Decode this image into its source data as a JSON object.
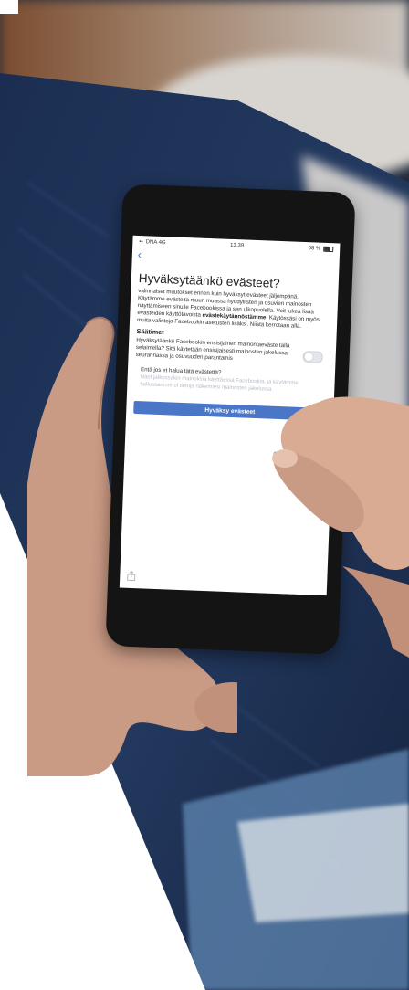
{
  "status_bar": {
    "carrier": "DNA 4G",
    "time": "13.39",
    "battery": "68 %"
  },
  "nav": {
    "back_icon": "chevron-left-icon"
  },
  "dialog": {
    "title": "Hyväksytäänkö evästeet?",
    "intro": "valinnaiset muutokset ennen kuin hyväksyt evästeet jäljempänä.",
    "body_before_link": "Käytämme evästeitä muun muassa hyödyllisten ja osuvien mainosten näyttämiseen sinulle Facebookissa ja sen ulkopuolella. Voit lukea lisää evästeiden käyttötavoista",
    "policy_link": "evästekäytännöstämme",
    "body_after_link": ". Käytössäsi on myös muita valintoja Facebookin asetusten lisäksi. Niistä kerrotaan alla.",
    "controls_title": "Säätimet",
    "toggle_text": "Hyväksytäänkö Facebookin ensisijainen mainontaeväste tällä selaimella? Sitä käytetään ensisijaisesti mainosten jakelussa, seurannassa ja osuvuuden parantamis",
    "question": "Entä jos et halua tätä evästettä?",
    "answer": "Näet jatkossakin mainoksia käyttäessä Facebookia, ja käytämme hallussamme ol tietoja näkemiesi mainosten jakelussa.",
    "accept_button": "Hyväksy evästeet",
    "share_icon": "share-icon"
  },
  "colors": {
    "brand_blue": "#4a76c8",
    "background": "#ffffff"
  }
}
